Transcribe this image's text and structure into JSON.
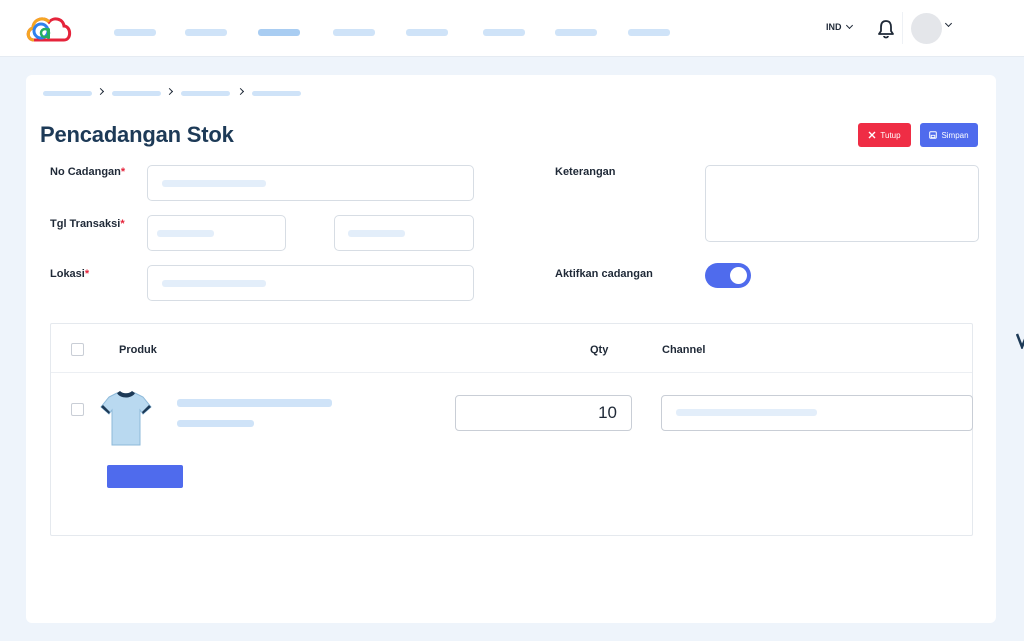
{
  "colors": {
    "accent": "#4f6bed",
    "danger": "#ef2d45",
    "title": "#1d3a57",
    "placeholder": "#cfe3f8",
    "background": "#eef4fb"
  },
  "topbar": {
    "language": "IND",
    "icons": [
      "cloud-logo",
      "bell-icon",
      "avatar",
      "chevron-down-icon"
    ]
  },
  "page": {
    "title": "Pencadangan Stok"
  },
  "actions": {
    "close_label": "Tutup",
    "save_label": "Simpan"
  },
  "form": {
    "no_cadangan_label": "No Cadangan",
    "tgl_transaksi_label": "Tgl Transaksi",
    "lokasi_label": "Lokasi",
    "keterangan_label": "Keterangan",
    "aktifkan_label": "Aktifkan cadangan",
    "required_mark": "*",
    "aktifkan_enabled": true
  },
  "table": {
    "headers": {
      "produk": "Produk",
      "qty": "Qty",
      "channel": "Channel"
    },
    "rows": [
      {
        "qty": "10"
      }
    ]
  }
}
